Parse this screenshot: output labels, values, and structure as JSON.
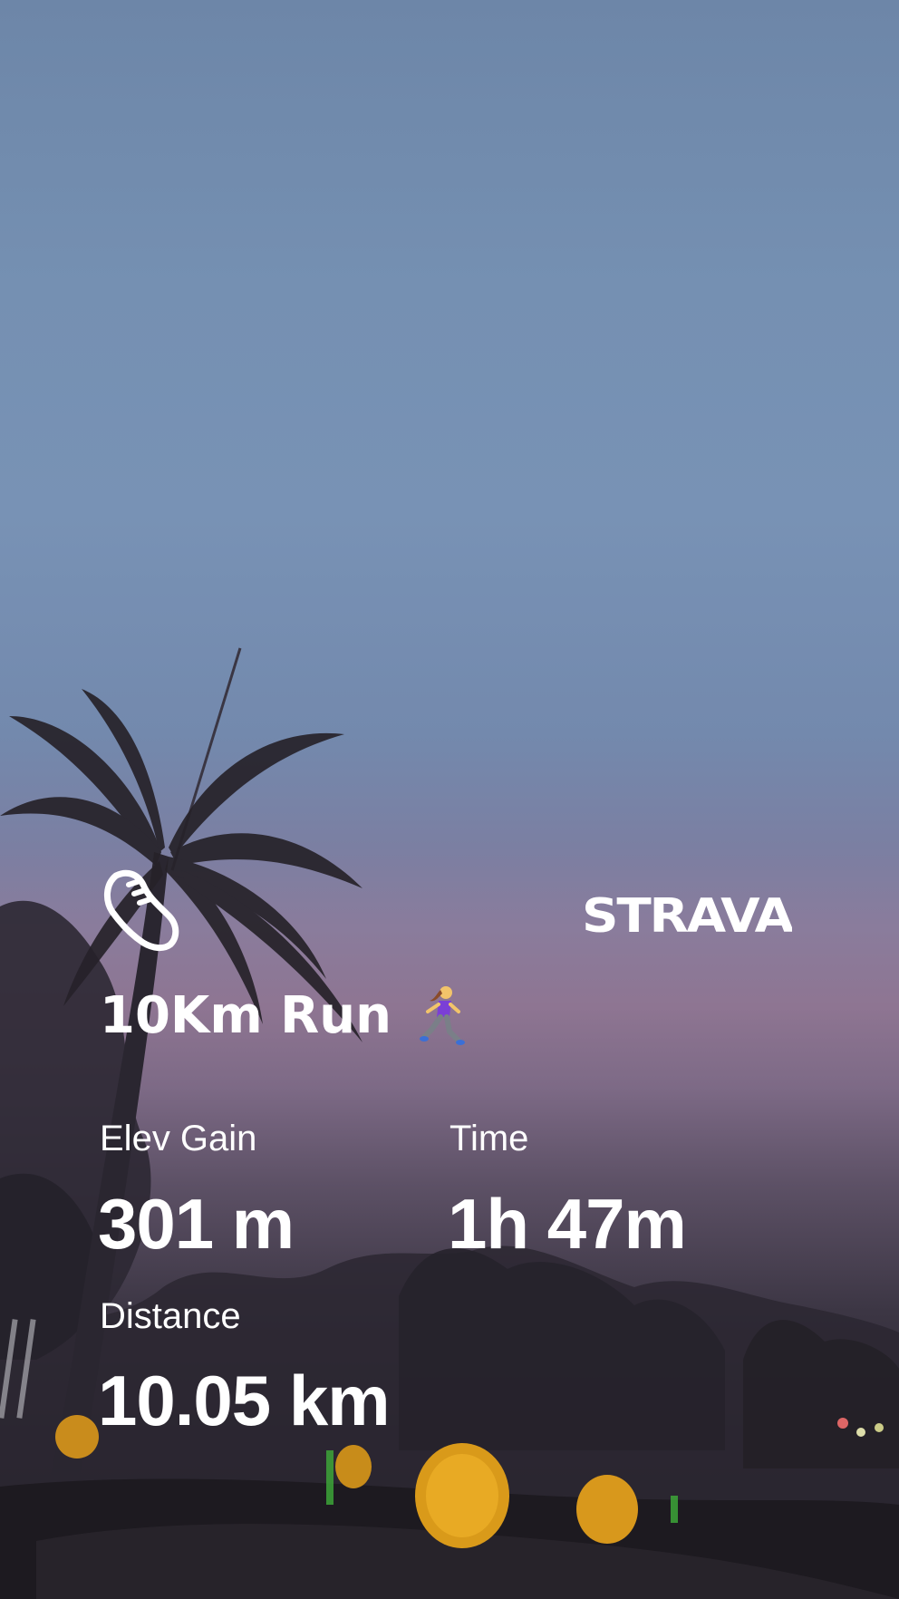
{
  "activity": {
    "title": "10Km Run",
    "title_emoji": "woman-running-icon"
  },
  "brand": {
    "name": "STRAVA",
    "logo_icon": "strava-logo",
    "activity_icon": "running-shoe-icon"
  },
  "stats": {
    "elev_gain": {
      "label": "Elev Gain",
      "value": "301 m"
    },
    "time": {
      "label": "Time",
      "value": "1h 47m"
    },
    "distance": {
      "label": "Distance",
      "value": "10.05 km"
    }
  },
  "colors": {
    "text": "#ffffff",
    "sky_top": "#6d86a8",
    "sky_dusk": "#8e7592",
    "ground": "#1f1c23",
    "lantern": "#e8a21c"
  }
}
